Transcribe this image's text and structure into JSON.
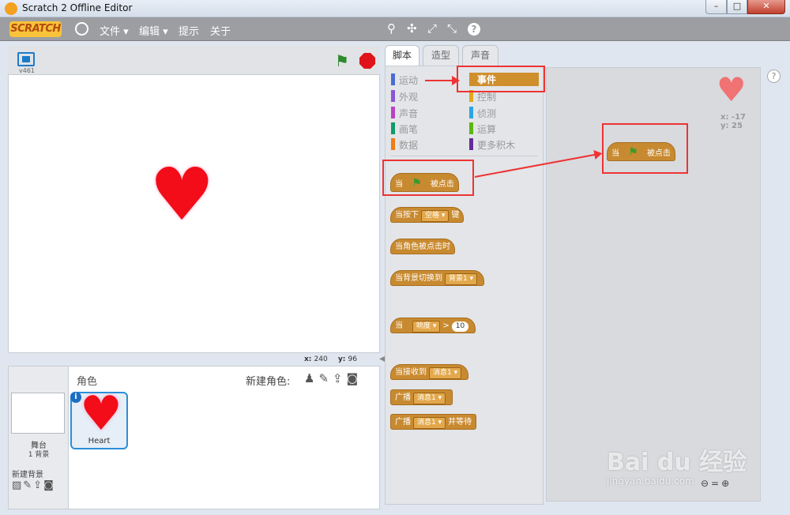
{
  "window": {
    "title": "Scratch 2 Offline Editor",
    "min": "–",
    "max": "□",
    "close": "✕"
  },
  "menubar": {
    "logo": "SCRATCH",
    "items": [
      "文件",
      "编辑",
      "提示",
      "关于"
    ],
    "tools": [
      "⚲",
      "✣",
      "⤢",
      "⤡",
      "?"
    ]
  },
  "stage": {
    "version": "v461",
    "flag": "⚑",
    "heart": "♥",
    "coords": {
      "x_label": "x:",
      "x_value": "240",
      "y_label": "y:",
      "y_value": "96"
    }
  },
  "sprites": {
    "title": "角色",
    "new_sprite": "新建角色:",
    "new_icons": "♟✎⇪◙",
    "stage_label": "舞台",
    "stage_sub": "1 背景",
    "new_bg": "新建背景",
    "bg_icons": "▨✎⇪◙",
    "sprite_name": "Heart",
    "info": "i"
  },
  "tabs": [
    "脚本",
    "造型",
    "声音"
  ],
  "categories": [
    {
      "label": "运动",
      "color": "#4a6cd4"
    },
    {
      "label": "外观",
      "color": "#8a55d7"
    },
    {
      "label": "声音",
      "color": "#bb42c3"
    },
    {
      "label": "画笔",
      "color": "#0e9a6c"
    },
    {
      "label": "数据",
      "color": "#ee7d16"
    },
    {
      "label": "事件",
      "color": "#c88330"
    },
    {
      "label": "控制",
      "color": "#e1a91a"
    },
    {
      "label": "侦测",
      "color": "#2ca5e2"
    },
    {
      "label": "运算",
      "color": "#5cb712"
    },
    {
      "label": "更多积木",
      "color": "#632d99"
    }
  ],
  "blocks": {
    "flag_when": "当",
    "flag_clicked": "被点击",
    "key_pressed_a": "当按下",
    "key_value": "空格",
    "key_pressed_b": "键",
    "sprite_clicked": "当角色被点击时",
    "backdrop_switch": "当背景切换到",
    "backdrop_value": "背景1",
    "sensor_when": "当",
    "sensor_value": "响度",
    "sensor_op": ">",
    "sensor_num": "10",
    "receive": "当接收到",
    "msg_value": "消息1",
    "broadcast": "广播",
    "broadcast_wait": "并等待"
  },
  "scripts": {
    "help": "?",
    "sprite_x": "x: -17",
    "sprite_y": "y: 25",
    "zoom": "⊖=⊕"
  },
  "watermark": {
    "brand": "Bai du 经验",
    "url": "jingyan.baidu.com"
  }
}
